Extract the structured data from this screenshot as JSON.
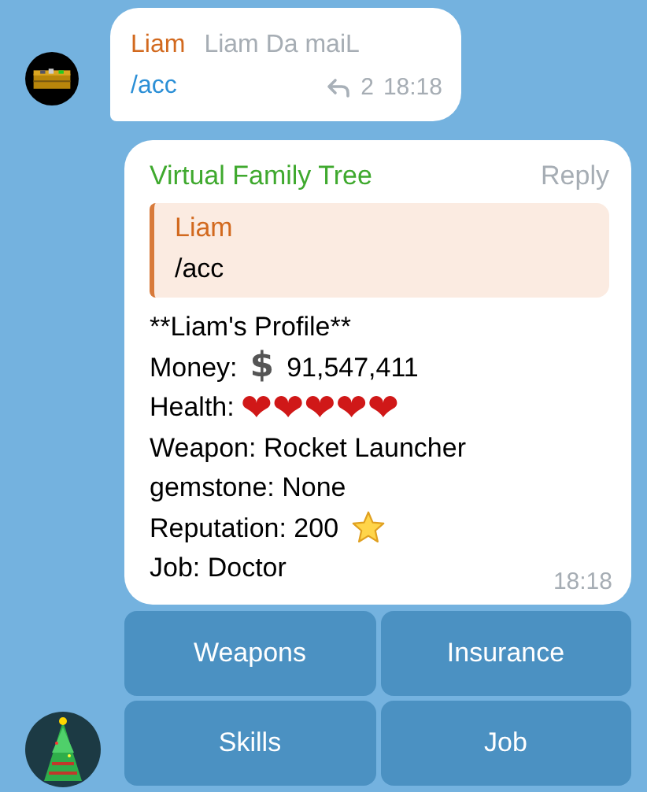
{
  "messages": [
    {
      "sender": "Liam",
      "signature": "Liam Da maiL",
      "text": "/acc",
      "reply_count": "2",
      "time": "18:18"
    },
    {
      "sender": "Virtual Family Tree",
      "action": "Reply",
      "quote": {
        "sender": "Liam",
        "text": "/acc"
      },
      "lines": [
        {
          "kind": "text",
          "text": "**Liam's Profile**"
        },
        {
          "kind": "money",
          "label": "Money:",
          "symbol": "$",
          "value": "91,547,411"
        },
        {
          "kind": "hearts",
          "label": "Health:",
          "hearts": "❤❤❤❤❤"
        },
        {
          "kind": "text",
          "text": "Weapon: Rocket Launcher"
        },
        {
          "kind": "text",
          "text": "gemstone: None"
        },
        {
          "kind": "star",
          "text": "Reputation: 200"
        },
        {
          "kind": "text",
          "text": "Job: Doctor"
        }
      ],
      "time": "18:18"
    }
  ],
  "keyboard": [
    [
      "Weapons",
      "Insurance"
    ],
    [
      "Skills",
      "Job"
    ]
  ]
}
